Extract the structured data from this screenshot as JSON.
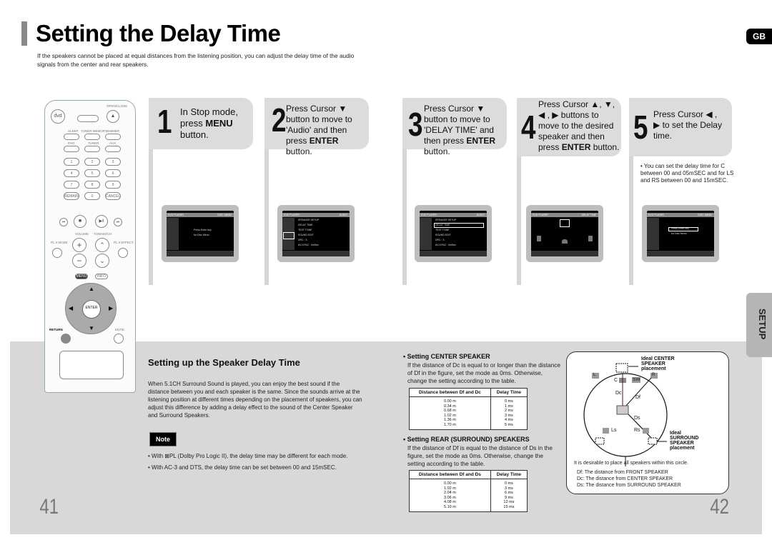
{
  "header": {
    "title": "Setting the Delay Time",
    "intro": "If the speakers cannot be placed at equal distances from the listening position, you can adjust the delay time of the audio signals from the center and rear speakers.",
    "language_tab": "GB"
  },
  "remote": {
    "top_labels": [
      "OPEN/CLOSE"
    ],
    "row_labels": [
      "SLEEP",
      "TUNER MEMORY",
      "DIMMER",
      "DVD",
      "TUNER",
      "AUX"
    ],
    "numbers": [
      "1",
      "2",
      "3",
      "4",
      "5",
      "6",
      "7",
      "8",
      "9",
      "REMAIN",
      "0",
      "CANCEL"
    ],
    "labels": {
      "dvd": "dvd",
      "volume": "VOLUME",
      "tuning": "TUNING/CH",
      "pl_mode": "PL II MODE",
      "pl_effect": "PL II EFFECT",
      "menu": "MENU",
      "info": "INFO",
      "enter": "ENTER",
      "return": "RETURN",
      "mute": "MUTE"
    }
  },
  "steps": [
    {
      "number": "1",
      "text_html": "In Stop mode, press <b>MENU</b> button."
    },
    {
      "number": "2",
      "text_html": "Press Cursor ▼ button to move to 'Audio' and then press <b>ENTER</b> button."
    },
    {
      "number": "3",
      "text_html": "Press Cursor ▼ button to move to 'DELAY TIME' and then press <b>ENTER</b> button."
    },
    {
      "number": "4",
      "text_html": "Press Cursor ▲, ▼, ◀ , ▶ buttons to move to the desired speaker and then press <b>ENTER</b> button."
    },
    {
      "number": "5",
      "text_html": "Press Cursor ◀ , ▶ to set the Delay time."
    }
  ],
  "step5_note": "• You can set the delay time for C between 00 and 05mSEC and for LS and RS between 00 and 15mSEC.",
  "screens": [
    {
      "header_left": "DVD PLAYER",
      "header_right": "DISC MENU",
      "lines": [
        "Press Enter key",
        "for Disc Menu"
      ]
    },
    {
      "header_left": "DVD PLAYER",
      "header_right": "AUDIO",
      "lines": [
        "SPEAKER SETUP",
        "DELAY TIME",
        "TEST TONE",
        "SOUND EDIT",
        "DRC   : 3",
        "AV-SYNC   : 0mSec"
      ]
    },
    {
      "header_left": "DVD PLAYER",
      "header_right": "AUDIO",
      "lines": [
        "SPEAKER SETUP",
        "DELAY TIME",
        "TEST TONE",
        "SOUND EDIT",
        "DRC   : 3",
        "AV-SYNC   : 0mSec"
      ]
    },
    {
      "header_left": "DVD PLAYER",
      "header_right": "DELAY TIME",
      "lines": []
    },
    {
      "header_left": "DVD PLAYER",
      "header_right": "DISC MENU",
      "lines": [
        "Press Enter key",
        "for Disc Menu"
      ]
    }
  ],
  "speaker_delay": {
    "title": "Setting up the Speaker Delay Time",
    "body": "When 5.1CH Surround Sound is played, you can enjoy the best sound if the distance between you and each speaker is the same. Since the sounds arrive at the listening position at different times depending on the placement of speakers, you can adjust this difference by adding a delay effect to the sound of the Center Speaker and Surround Speakers.",
    "note_label": "Note",
    "notes": [
      "• With ⊠PL (Dolby Pro Logic II), the delay time may be different for each mode.",
      "• With AC-3 and DTS, the delay time can be set between 00 and 15mSEC."
    ]
  },
  "center_section": {
    "title": "• Setting CENTER SPEAKER",
    "body": "If the distance of Dc is equal to or longer than the distance of Df in the figure, set the mode as 0ms. Otherwise, change the setting according to the table.",
    "table": {
      "headers": [
        "Distance between Df and Dc",
        "Delay Time"
      ],
      "rows": [
        [
          "0.00 m",
          "0 ms"
        ],
        [
          "0.34 m",
          "1 ms"
        ],
        [
          "0.68 m",
          "2 ms"
        ],
        [
          "1.02 m",
          "3 ms"
        ],
        [
          "1.36 m",
          "4 ms"
        ],
        [
          "1.70 m",
          "5 ms"
        ]
      ]
    }
  },
  "rear_section": {
    "title": "• Setting REAR (SURROUND) SPEAKERS",
    "body": "If the distance of Df is equal to the distance of Ds in the figure, set the mode as 0ms. Otherwise, change the setting according to the table.",
    "table": {
      "headers": [
        "Distance between Df and Ds",
        "Delay Time"
      ],
      "rows": [
        [
          "0.00 m",
          "0 ms"
        ],
        [
          "1.02 m",
          "3 ms"
        ],
        [
          "2.04 m",
          "6 ms"
        ],
        [
          "3.06 m",
          "9 ms"
        ],
        [
          "4.08 m",
          "12 ms"
        ],
        [
          "5.10 m",
          "15 ms"
        ]
      ]
    }
  },
  "diagram": {
    "ideal_center": "Ideal CENTER SPEAKER placement",
    "ideal_surround": "Ideal SURROUND SPEAKER placement",
    "speakers": {
      "L": "L",
      "C": "C",
      "SW": "SW",
      "R": "R",
      "Ls": "Ls",
      "Rs": "Rs"
    },
    "distances": {
      "Dc": "Dc",
      "Df": "Df",
      "Ds": "Ds"
    },
    "caption": "It is desirable to place all speakers within this circle.",
    "legend": [
      "Df: The distance from FRONT SPEAKER",
      "Dc: The distance from CENTER SPEAKER",
      "Ds: The distance from SURROUND SPEAKER"
    ]
  },
  "side_tab": "SETUP",
  "page_numbers": {
    "left": "41",
    "right": "42"
  }
}
